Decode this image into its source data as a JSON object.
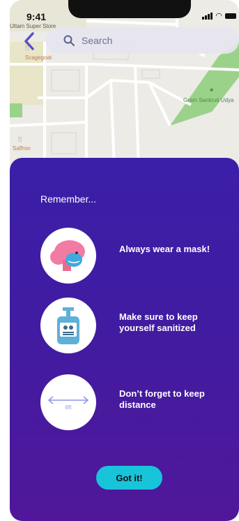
{
  "status_bar": {
    "time": "9:41"
  },
  "map": {
    "labels": {
      "store": "Uttam Super Store",
      "scagegoat": "Scagegoat",
      "park": "Gram Sankruti Udya",
      "saffron": "Saffron"
    }
  },
  "search": {
    "placeholder": "Search"
  },
  "sheet": {
    "heading": "Remember...",
    "tips": [
      {
        "text": "Always wear a mask!"
      },
      {
        "text_line1": "Make sure to keep",
        "text_line2": "yourself sanitized"
      },
      {
        "text_line1": "Don’t forget to keep",
        "text_line2": "distance",
        "badge": "6ft"
      }
    ],
    "button": "Got it!"
  },
  "colors": {
    "accent": "#18c4d9",
    "sheet_top": "#3b1fa8",
    "sheet_bottom": "#50179a"
  }
}
